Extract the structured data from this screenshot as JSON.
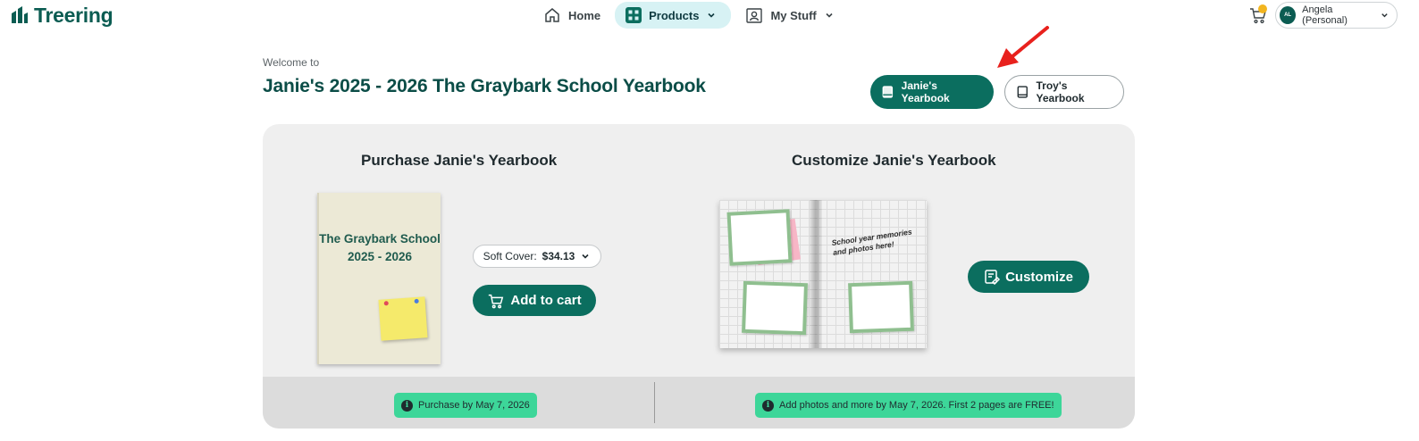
{
  "header": {
    "logo_text": "Treering",
    "nav": [
      {
        "label": "Home",
        "icon": "home-icon"
      },
      {
        "label": "Products",
        "icon": "grid-icon",
        "active": true
      },
      {
        "label": "My Stuff",
        "icon": "profile-icon"
      }
    ],
    "account_initials": "AL",
    "account_label": "Angela (Personal)"
  },
  "welcome": {
    "eyebrow": "Welcome to",
    "title": "Janie's 2025 - 2026 The Graybark School Yearbook"
  },
  "yearbook_switch": {
    "janie": "Janie's Yearbook",
    "troy": "Troy's Yearbook"
  },
  "purchase": {
    "title": "Purchase Janie's Yearbook",
    "book_title_line1": "The Graybark School",
    "book_title_line2": "2025 - 2026",
    "cover_label": "Soft Cover:",
    "cover_price": "$34.13",
    "add_to_cart": "Add to cart",
    "deadline": "Purchase by May 7, 2026"
  },
  "customize": {
    "title": "Customize Janie's Yearbook",
    "spread_text": "School year memories and photos here!",
    "button": "Customize",
    "deadline": "Add photos and more by May 7, 2026. First 2 pages are FREE!"
  },
  "colors": {
    "brand": "#0b6e5f",
    "brand_dark": "#0b4d47",
    "nav_active_bg": "#d7f2f4",
    "pill_green": "#3dd699",
    "annotation_arrow": "#e8211d"
  }
}
